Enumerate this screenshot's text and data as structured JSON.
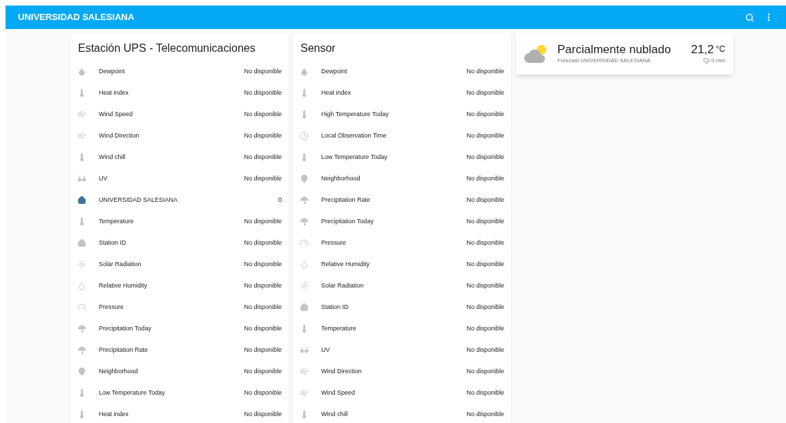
{
  "header": {
    "title": "UNIVERSIDAD SALESIANA"
  },
  "cards": [
    {
      "title": "Estación UPS - Telecomunicaciones",
      "rows": [
        {
          "kind": "drop",
          "label": "Dewpoint",
          "value": "No disponible",
          "active": false
        },
        {
          "kind": "thermometer",
          "label": "Heat index",
          "value": "No disponible",
          "active": false
        },
        {
          "kind": "wind",
          "label": "Wind Speed",
          "value": "No disponible",
          "active": false
        },
        {
          "kind": "wind",
          "label": "Wind Direction",
          "value": "No disponible",
          "active": false
        },
        {
          "kind": "thermometer",
          "label": "Wind chill",
          "value": "No disponible",
          "active": false
        },
        {
          "kind": "glasses",
          "label": "UV",
          "value": "No disponible",
          "active": false
        },
        {
          "kind": "home",
          "label": "UNIVERSIDAD SALESIANA",
          "value": "0",
          "active": true
        },
        {
          "kind": "thermometer",
          "label": "Temperature",
          "value": "No disponible",
          "active": false
        },
        {
          "kind": "home",
          "label": "Station ID",
          "value": "No disponible",
          "active": false
        },
        {
          "kind": "sun",
          "label": "Solar Radiation",
          "value": "No disponible",
          "active": false
        },
        {
          "kind": "humidity",
          "label": "Relative Humidity",
          "value": "No disponible",
          "active": false
        },
        {
          "kind": "gauge",
          "label": "Pressure",
          "value": "No disponible",
          "active": false
        },
        {
          "kind": "umbrella",
          "label": "Precipitation Today",
          "value": "No disponible",
          "active": false
        },
        {
          "kind": "umbrella",
          "label": "Precipitation Rate",
          "value": "No disponible",
          "active": false
        },
        {
          "kind": "pin",
          "label": "Neighborhood",
          "value": "No disponible",
          "active": false
        },
        {
          "kind": "thermometer",
          "label": "Low Temperature Today",
          "value": "No disponible",
          "active": false
        },
        {
          "kind": "thermometer",
          "label": "Heat index",
          "value": "No disponible",
          "active": false
        }
      ]
    },
    {
      "title": "Sensor",
      "rows": [
        {
          "kind": "drop",
          "label": "Dewpoint",
          "value": "No disponible",
          "active": false
        },
        {
          "kind": "thermometer",
          "label": "Heat index",
          "value": "No disponible",
          "active": false
        },
        {
          "kind": "thermometer",
          "label": "High Temperature Today",
          "value": "No disponible",
          "active": false
        },
        {
          "kind": "clock",
          "label": "Local Observation Time",
          "value": "No disponible",
          "active": false
        },
        {
          "kind": "thermometer",
          "label": "Low Temperature Today",
          "value": "No disponible",
          "active": false
        },
        {
          "kind": "pin",
          "label": "Neighborhood",
          "value": "No disponible",
          "active": false
        },
        {
          "kind": "umbrella",
          "label": "Precipitation Rate",
          "value": "No disponible",
          "active": false
        },
        {
          "kind": "umbrella",
          "label": "Precipitation Today",
          "value": "No disponible",
          "active": false
        },
        {
          "kind": "gauge",
          "label": "Pressure",
          "value": "No disponible",
          "active": false
        },
        {
          "kind": "humidity",
          "label": "Relative Humidity",
          "value": "No disponible",
          "active": false
        },
        {
          "kind": "sun",
          "label": "Solar Radiation",
          "value": "No disponible",
          "active": false
        },
        {
          "kind": "home",
          "label": "Station ID",
          "value": "No disponible",
          "active": false
        },
        {
          "kind": "thermometer",
          "label": "Temperature",
          "value": "No disponible",
          "active": false
        },
        {
          "kind": "glasses",
          "label": "UV",
          "value": "No disponible",
          "active": false
        },
        {
          "kind": "wind",
          "label": "Wind Direction",
          "value": "No disponible",
          "active": false
        },
        {
          "kind": "wind",
          "label": "Wind Speed",
          "value": "No disponible",
          "active": false
        },
        {
          "kind": "thermometer",
          "label": "Wind chill",
          "value": "No disponible",
          "active": false
        }
      ]
    }
  ],
  "weather": {
    "condition": "Parcialmente nublado",
    "subtitle": "Forecast UNIVERSIDAD SALESIANA",
    "temperature": "21,2",
    "unit": "°C",
    "precipitation": "0 mm"
  }
}
